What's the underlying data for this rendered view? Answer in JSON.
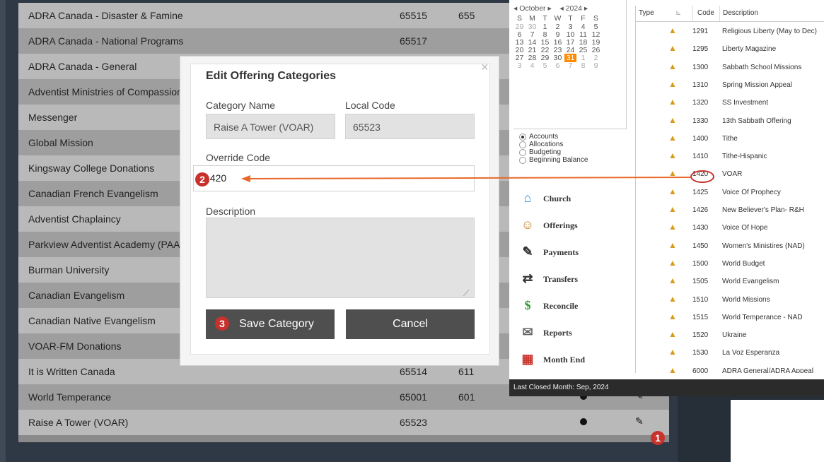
{
  "background_list": {
    "rows": [
      {
        "name": "ADRA Canada - Disaster & Famine",
        "code": "65515",
        "local": "655"
      },
      {
        "name": "ADRA Canada - National Programs",
        "code": "65517",
        "local": ""
      },
      {
        "name": "ADRA Canada - General",
        "code": "",
        "local": ""
      },
      {
        "name": "Adventist Ministries of Compassion",
        "code": "",
        "local": ""
      },
      {
        "name": "Messenger",
        "code": "",
        "local": ""
      },
      {
        "name": "Global Mission",
        "code": "",
        "local": ""
      },
      {
        "name": "Kingsway College Donations",
        "code": "",
        "local": ""
      },
      {
        "name": "Canadian French Evangelism",
        "code": "",
        "local": ""
      },
      {
        "name": "Adventist Chaplaincy",
        "code": "",
        "local": ""
      },
      {
        "name": "Parkview Adventist Academy (PAA",
        "code": "",
        "local": ""
      },
      {
        "name": "Burman University",
        "code": "",
        "local": ""
      },
      {
        "name": "Canadian Evangelism",
        "code": "",
        "local": ""
      },
      {
        "name": "Canadian Native Evangelism",
        "code": "",
        "local": ""
      },
      {
        "name": "VOAR-FM Donations",
        "code": "",
        "local": ""
      },
      {
        "name": "It is Written Canada",
        "code": "65514",
        "local": "611"
      },
      {
        "name": "World Temperance",
        "code": "65001",
        "local": "601"
      },
      {
        "name": "Raise A Tower (VOAR)",
        "code": "65523",
        "local": ""
      }
    ]
  },
  "modal": {
    "title": "Edit Offering Categories",
    "close": "×",
    "category_name_label": "Category Name",
    "category_name_value": "Raise A Tower (VOAR)",
    "local_code_label": "Local Code",
    "local_code_value": "65523",
    "override_code_label": "Override Code",
    "override_code_value": "1420",
    "description_label": "Description",
    "description_value": "",
    "save_label": "Save Category",
    "cancel_label": "Cancel"
  },
  "badges": {
    "one": "1",
    "two": "2",
    "three": "3"
  },
  "calendar": {
    "month": "October",
    "year": "2024",
    "prev": "◂",
    "next": "▸",
    "weekdays": [
      "S",
      "M",
      "T",
      "W",
      "T",
      "F",
      "S"
    ],
    "weeks": [
      [
        "29",
        "30",
        "1",
        "2",
        "3",
        "4",
        "5"
      ],
      [
        "6",
        "7",
        "8",
        "9",
        "10",
        "11",
        "12"
      ],
      [
        "13",
        "14",
        "15",
        "16",
        "17",
        "18",
        "19"
      ],
      [
        "20",
        "21",
        "22",
        "23",
        "24",
        "25",
        "26"
      ],
      [
        "27",
        "28",
        "29",
        "30",
        "31",
        "1",
        "2"
      ],
      [
        "3",
        "4",
        "5",
        "6",
        "7",
        "8",
        "9"
      ]
    ],
    "selected": "31"
  },
  "radios": [
    "Accounts",
    "Allocations",
    "Budgeting",
    "Beginning Balance"
  ],
  "radio_selected": "Accounts",
  "nav": [
    {
      "label": "Church",
      "icon": "church-icon"
    },
    {
      "label": "Offerings",
      "icon": "offerings-icon"
    },
    {
      "label": "Payments",
      "icon": "payments-icon"
    },
    {
      "label": "Transfers",
      "icon": "transfers-icon"
    },
    {
      "label": "Reconcile",
      "icon": "reconcile-icon"
    },
    {
      "label": "Reports",
      "icon": "reports-icon"
    },
    {
      "label": "Month End",
      "icon": "calendar-icon"
    }
  ],
  "status_bar": "Last Closed Month: Sep, 2024",
  "codes_table": {
    "headers": {
      "type": "Type",
      "code": "Code",
      "description": "Description"
    },
    "rows": [
      {
        "code": "1291",
        "description": "Religious Liberty (May to Dec)"
      },
      {
        "code": "1295",
        "description": "Liberty Magazine"
      },
      {
        "code": "1300",
        "description": "Sabbath School Missions"
      },
      {
        "code": "1310",
        "description": "Spring Mission Appeal"
      },
      {
        "code": "1320",
        "description": "SS Investment"
      },
      {
        "code": "1330",
        "description": "13th Sabbath Offering"
      },
      {
        "code": "1400",
        "description": "Tithe"
      },
      {
        "code": "1410",
        "description": "Tithe-Hispanic"
      },
      {
        "code": "1420",
        "description": "VOAR"
      },
      {
        "code": "1425",
        "description": "Voice Of Prophecy"
      },
      {
        "code": "1426",
        "description": "New Believer's Plan- R&H"
      },
      {
        "code": "1430",
        "description": "Voice Of Hope"
      },
      {
        "code": "1450",
        "description": "Women's Ministires (NAD)"
      },
      {
        "code": "1500",
        "description": "World Budget"
      },
      {
        "code": "1505",
        "description": "World Evangelism"
      },
      {
        "code": "1510",
        "description": "World Missions"
      },
      {
        "code": "1515",
        "description": "World Temperance - NAD"
      },
      {
        "code": "1520",
        "description": "Ukraine"
      },
      {
        "code": "1530",
        "description": "La Voz Esperanza"
      },
      {
        "code": "6000",
        "description": "ADRA General/ADRA Appeal"
      }
    ]
  },
  "colors": {
    "accent_red": "#c7322c",
    "arrow_orange": "#e8692a",
    "selected_day": "#ff8a00"
  }
}
